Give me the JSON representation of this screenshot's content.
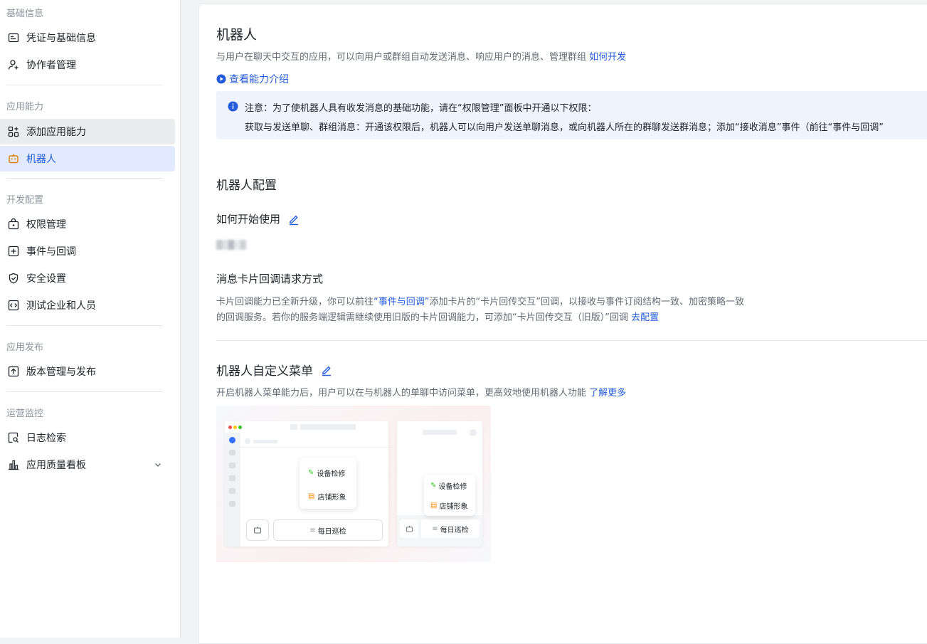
{
  "sidebar": {
    "sections": [
      {
        "title": "基础信息",
        "items": [
          {
            "label": "凭证与基础信息",
            "icon": "credential-icon"
          },
          {
            "label": "协作者管理",
            "icon": "user-add-icon"
          }
        ]
      },
      {
        "title": "应用能力",
        "items": [
          {
            "label": "添加应用能力",
            "icon": "add-app-icon"
          },
          {
            "label": "机器人",
            "icon": "robot-icon"
          }
        ]
      },
      {
        "title": "开发配置",
        "items": [
          {
            "label": "权限管理",
            "icon": "lock-bag-icon"
          },
          {
            "label": "事件与回调",
            "icon": "event-icon"
          },
          {
            "label": "安全设置",
            "icon": "shield-icon"
          },
          {
            "label": "测试企业和人员",
            "icon": "code-icon"
          }
        ]
      },
      {
        "title": "应用发布",
        "items": [
          {
            "label": "版本管理与发布",
            "icon": "upload-icon"
          }
        ]
      },
      {
        "title": "运营监控",
        "items": [
          {
            "label": "日志检索",
            "icon": "log-search-icon"
          },
          {
            "label": "应用质量看板",
            "icon": "bar-chart-icon"
          }
        ]
      }
    ]
  },
  "main": {
    "title": "机器人",
    "description": "与用户在聊天中交互的应用，可以向用户或群组自动发送消息、响应用户的消息、管理群组",
    "description_link": "如何开发",
    "intro_link": "查看能力介绍",
    "notice": {
      "line1": "注意：为了使机器人具有收发消息的基础功能，请在“权限管理”面板中开通以下权限：",
      "line2": "获取与发送单聊、群组消息：开通该权限后，机器人可以向用户发送单聊消息，或向机器人所在的群聊发送群消息；添加“接收消息”事件（前往“事件与回调”"
    },
    "config_title": "机器人配置",
    "how_to_start": "如何开始使用",
    "card_callback_title": "消息卡片回调请求方式",
    "card_callback_p1": "卡片回调能力已全新升级，你可以前往",
    "card_callback_link1": "“事件与回调”",
    "card_callback_p2": "添加卡片的“卡片回传交互”回调，以接收与事件订阅结构一致、加密策略一致",
    "card_callback_p3": "的回调服务。若你的服务端逻辑需继续使用旧版的卡片回调能力，可添加“卡片回传交互（旧版）”回调",
    "card_callback_link2": "去配置",
    "menu_title": "机器人自定义菜单",
    "menu_desc": "开启机器人菜单能力后，用户可以在与机器人的单聊中访问菜单，更高效地使用机器人功能",
    "menu_link": "了解更多",
    "illustration": {
      "item1": "设备检修",
      "item2": "店铺形象",
      "button": "每日巡检"
    }
  },
  "colors": {
    "accent": "#245bdb",
    "active_bg": "#e1eaff",
    "notice_bg": "#f0f4ff"
  }
}
